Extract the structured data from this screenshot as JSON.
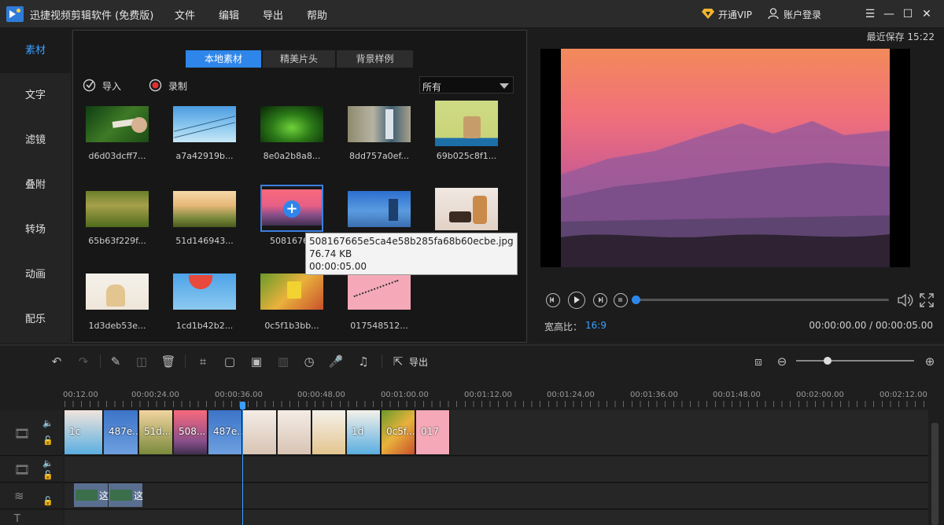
{
  "app": {
    "title": "迅捷视频剪辑软件 (免费版)"
  },
  "menu": [
    "文件",
    "编辑",
    "导出",
    "帮助"
  ],
  "titlebar_right": {
    "vip": "开通VIP",
    "login": "账户登录"
  },
  "left_nav": [
    "素材",
    "文字",
    "滤镜",
    "叠附",
    "转场",
    "动画",
    "配乐"
  ],
  "media": {
    "tabs": [
      "本地素材",
      "精美片头",
      "背景样例"
    ],
    "import_label": "导入",
    "record_label": "录制",
    "filter_value": "所有",
    "items": [
      {
        "label": "d6d03dcff7..."
      },
      {
        "label": "a7a42919b..."
      },
      {
        "label": "8e0a2b8a8..."
      },
      {
        "label": "8dd757a0ef..."
      },
      {
        "label": "69b025c8f1..."
      },
      {
        "label": "65b63f229f..."
      },
      {
        "label": "51d146943..."
      },
      {
        "label": "50816766"
      },
      {
        "label": ""
      },
      {
        "label": ""
      },
      {
        "label": "1d3deb53e..."
      },
      {
        "label": "1cd1b42b2..."
      },
      {
        "label": "0c5f1b3bb..."
      },
      {
        "label": "017548512..."
      }
    ],
    "tooltip": {
      "name": "508167665e5ca4e58b285fa68b60ecbe.jpg",
      "size": "76.74 KB",
      "duration": "00:00:05.00"
    }
  },
  "preview": {
    "last_saved": "最近保存 15:22",
    "aspect_label": "宽高比：",
    "aspect_value": "16:9",
    "time": "00:00:00.00 / 00:00:05.00",
    "progress": 0
  },
  "timeline": {
    "export_label": "导出",
    "ruler": [
      "00:12.00",
      "00:00:24.00",
      "00:00:36.00",
      "00:00:48.00",
      "00:01:00.00",
      "00:01:12.00",
      "00:01:24.00",
      "00:01:36.00",
      "00:01:48.00",
      "00:02:00.00",
      "00:02:12.00"
    ],
    "video_clips": [
      "1c",
      "487e...",
      "51d...",
      "508...",
      "487e...",
      "",
      "",
      "",
      "1d",
      "0c5f...",
      "017"
    ],
    "overlay_clips": [
      "这",
      "这"
    ]
  },
  "colors": {
    "accent": "#2e86ea",
    "playhead": "#3aa0ff"
  }
}
